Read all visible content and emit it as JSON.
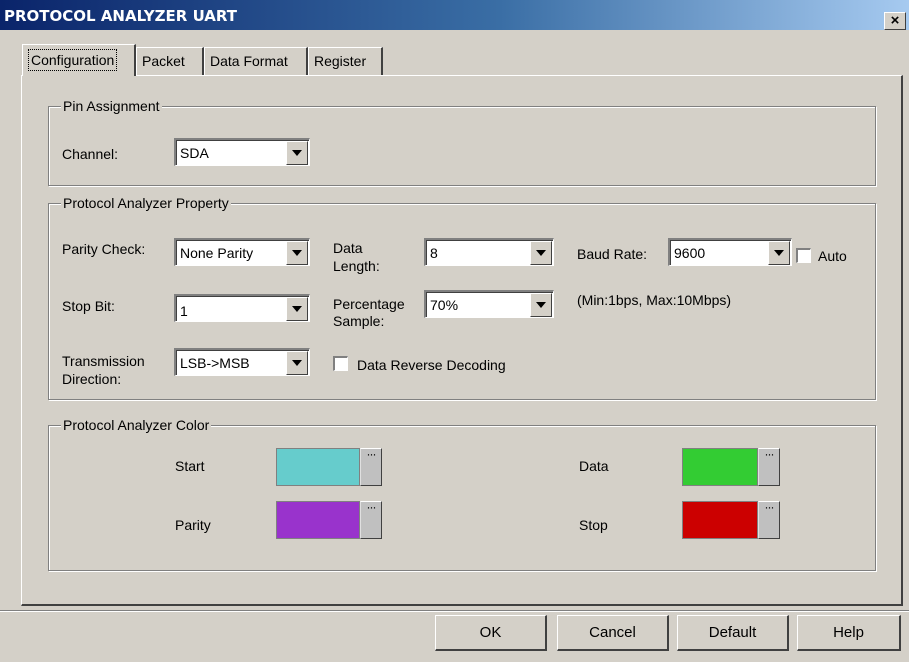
{
  "window": {
    "title": "PROTOCOL ANALYZER UART",
    "close_glyph": "×"
  },
  "tabs": [
    {
      "label": "Configuration",
      "active": true
    },
    {
      "label": "Packet",
      "active": false
    },
    {
      "label": "Data Format",
      "active": false
    },
    {
      "label": "Register",
      "active": false
    }
  ],
  "pin_assignment": {
    "title": "Pin Assignment",
    "channel": {
      "label": "Channel:",
      "value": "SDA"
    }
  },
  "property": {
    "title": "Protocol Analyzer Property",
    "parity_check": {
      "label": "Parity Check:",
      "value": "None Parity"
    },
    "data_length": {
      "label_line1": "Data",
      "label_line2": "Length:",
      "value": "8"
    },
    "baud_rate": {
      "label": "Baud Rate:",
      "value": "9600"
    },
    "auto": {
      "label": "Auto",
      "checked": false
    },
    "stop_bit": {
      "label": "Stop Bit:",
      "value": "1"
    },
    "percentage_sample": {
      "label_line1": "Percentage",
      "label_line2": "Sample:",
      "value": "70%"
    },
    "baud_range_note": "(Min:1bps, Max:10Mbps)",
    "transmission_direction": {
      "label_line1": "Transmission",
      "label_line2": "Direction:",
      "value": "LSB->MSB"
    },
    "data_reverse": {
      "label": "Data Reverse Decoding",
      "checked": false
    }
  },
  "colors": {
    "title": "Protocol Analyzer Color",
    "start": {
      "label": "Start",
      "color": "#66cccc"
    },
    "data": {
      "label": "Data",
      "color": "#33cc33"
    },
    "parity": {
      "label": "Parity",
      "color": "#9933cc"
    },
    "stop": {
      "label": "Stop",
      "color": "#cc0000"
    },
    "picker_glyph": "···"
  },
  "buttons": {
    "ok": "OK",
    "cancel": "Cancel",
    "default": "Default",
    "help": "Help"
  }
}
